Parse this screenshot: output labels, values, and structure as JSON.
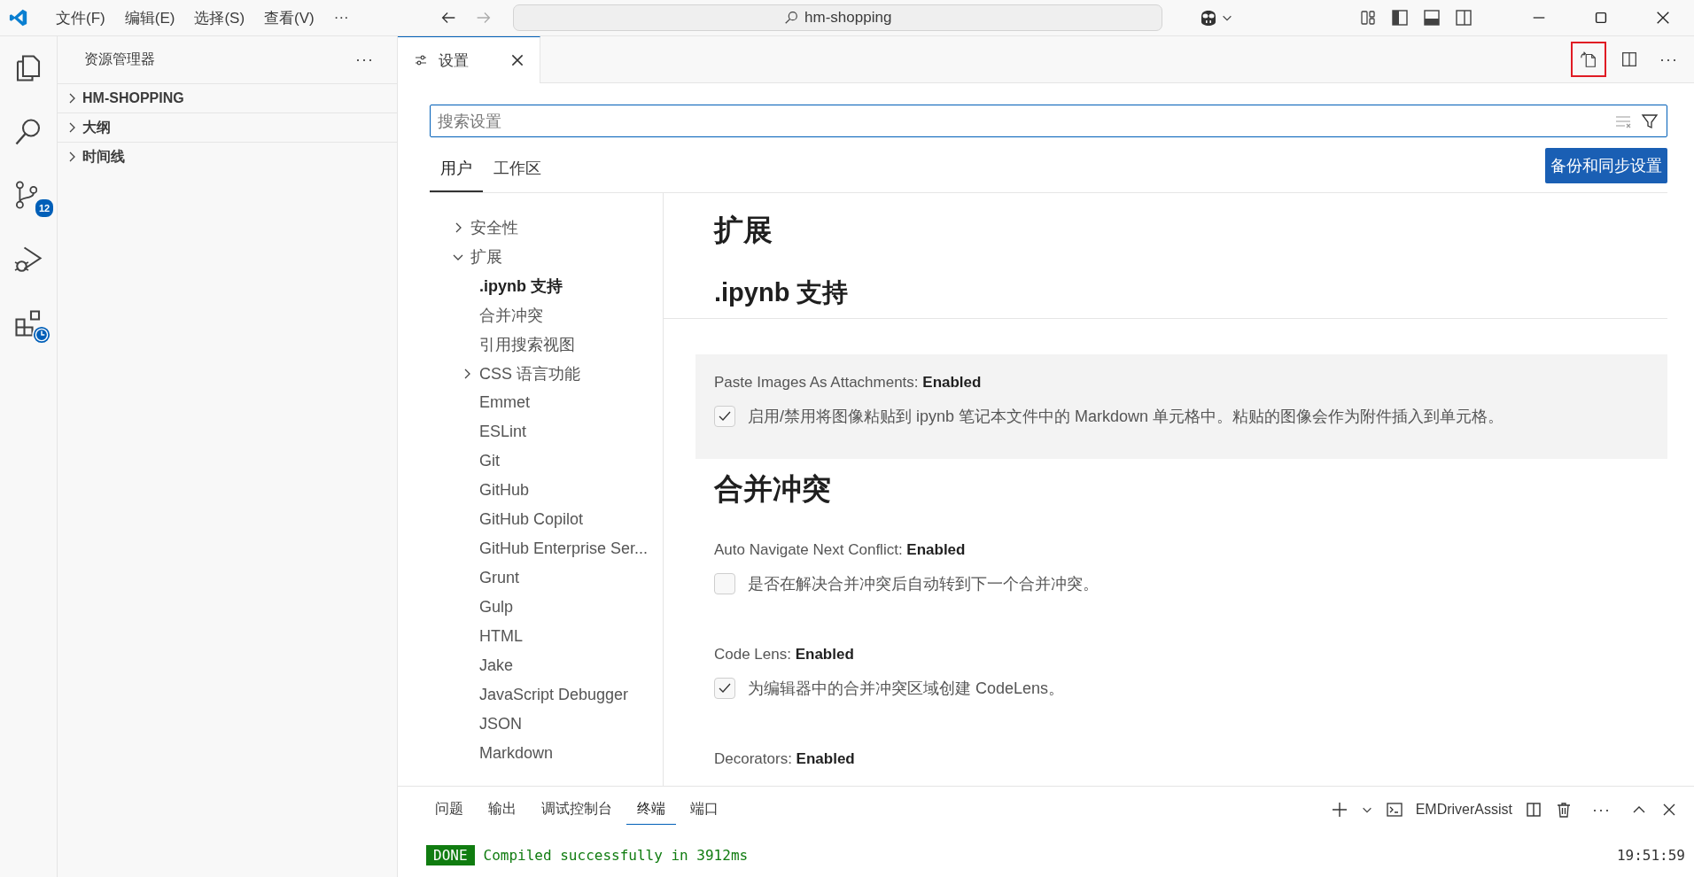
{
  "title_bar": {
    "menus": [
      "文件(F)",
      "编辑(E)",
      "选择(S)",
      "查看(V)",
      "···"
    ],
    "command_center": "hm-shopping"
  },
  "activity_bar": [
    {
      "kind": "explorer"
    },
    {
      "kind": "search"
    },
    {
      "kind": "scm",
      "badge": "12"
    },
    {
      "kind": "debug"
    },
    {
      "kind": "extensions"
    }
  ],
  "sidebar": {
    "title": "资源管理器",
    "more": "···",
    "sections": [
      {
        "label": "HM-SHOPPING",
        "expanded": false
      },
      {
        "label": "大纲",
        "expanded": false
      },
      {
        "label": "时间线",
        "expanded": false
      }
    ]
  },
  "editor_tabs": [
    {
      "label": "设置",
      "selected": true
    }
  ],
  "editor_actions": [
    {
      "kind": "open-json",
      "highlighted": true
    },
    {
      "kind": "split",
      "highlighted": false
    }
  ],
  "editor_more": "···",
  "settings": {
    "search_placeholder": "搜索设置",
    "scopes": [
      {
        "label": "用户",
        "selected": true
      },
      {
        "label": "工作区",
        "selected": false
      }
    ],
    "sync_button": "备份和同步设置",
    "toc": [
      {
        "label": "安全性",
        "kind": "folder",
        "expanded": false,
        "selected": false
      },
      {
        "label": "扩展",
        "kind": "folder",
        "expanded": true,
        "selected": false,
        "children": [
          {
            "label": ".ipynb 支持",
            "kind": "leaf",
            "selected": true
          },
          {
            "label": "合并冲突",
            "kind": "leaf",
            "selected": false
          },
          {
            "label": "引用搜索视图",
            "kind": "leaf",
            "selected": false
          },
          {
            "label": "CSS 语言功能",
            "kind": "folder",
            "expanded": false,
            "selected": false
          },
          {
            "label": "Emmet",
            "kind": "leaf",
            "selected": false
          },
          {
            "label": "ESLint",
            "kind": "leaf",
            "selected": false
          },
          {
            "label": "Git",
            "kind": "leaf",
            "selected": false
          },
          {
            "label": "GitHub",
            "kind": "leaf",
            "selected": false
          },
          {
            "label": "GitHub Copilot",
            "kind": "leaf",
            "selected": false
          },
          {
            "label": "GitHub Enterprise Ser...",
            "kind": "leaf",
            "selected": false
          },
          {
            "label": "Grunt",
            "kind": "leaf",
            "selected": false
          },
          {
            "label": "Gulp",
            "kind": "leaf",
            "selected": false
          },
          {
            "label": "HTML",
            "kind": "leaf",
            "selected": false
          },
          {
            "label": "Jake",
            "kind": "leaf",
            "selected": false
          },
          {
            "label": "JavaScript Debugger",
            "kind": "leaf",
            "selected": false
          },
          {
            "label": "JSON",
            "kind": "leaf",
            "selected": false
          },
          {
            "label": "Markdown",
            "kind": "leaf",
            "selected": false
          }
        ]
      }
    ],
    "content": {
      "category_title": "扩展",
      "section_title": ".ipynb 支持",
      "items": [
        {
          "kind": "setting",
          "title": "Paste Images As Attachments: **Enabled**",
          "description": "启用/禁用将图像粘贴到 ipynb 笔记本文件中的 Markdown 单元格中。粘贴的图像会作为附件插入到单元格。",
          "checked": true,
          "focused": true
        },
        {
          "kind": "heading",
          "text": "合并冲突"
        },
        {
          "kind": "setting",
          "title": "Auto Navigate Next Conflict: **Enabled**",
          "description": "是否在解决合并冲突后自动转到下一个合并冲突。",
          "checked": false,
          "focused": false
        },
        {
          "kind": "setting",
          "title": "Code Lens: **Enabled**",
          "description": "为编辑器中的合并冲突区域创建 CodeLens。",
          "checked": true,
          "focused": false
        },
        {
          "kind": "setting",
          "title": "Decorators: **Enabled**",
          "focused": false
        }
      ]
    }
  },
  "panel": {
    "tabs": [
      {
        "label": "问题",
        "selected": false
      },
      {
        "label": "输出",
        "selected": false
      },
      {
        "label": "调试控制台",
        "selected": false
      },
      {
        "label": "终端",
        "selected": true
      },
      {
        "label": "端口",
        "selected": false
      }
    ],
    "terminal_name": "EMDriverAssist",
    "more": "···",
    "output": {
      "badge": "DONE",
      "message": "Compiled successfully in 3912ms",
      "time": "19:51:59"
    }
  }
}
